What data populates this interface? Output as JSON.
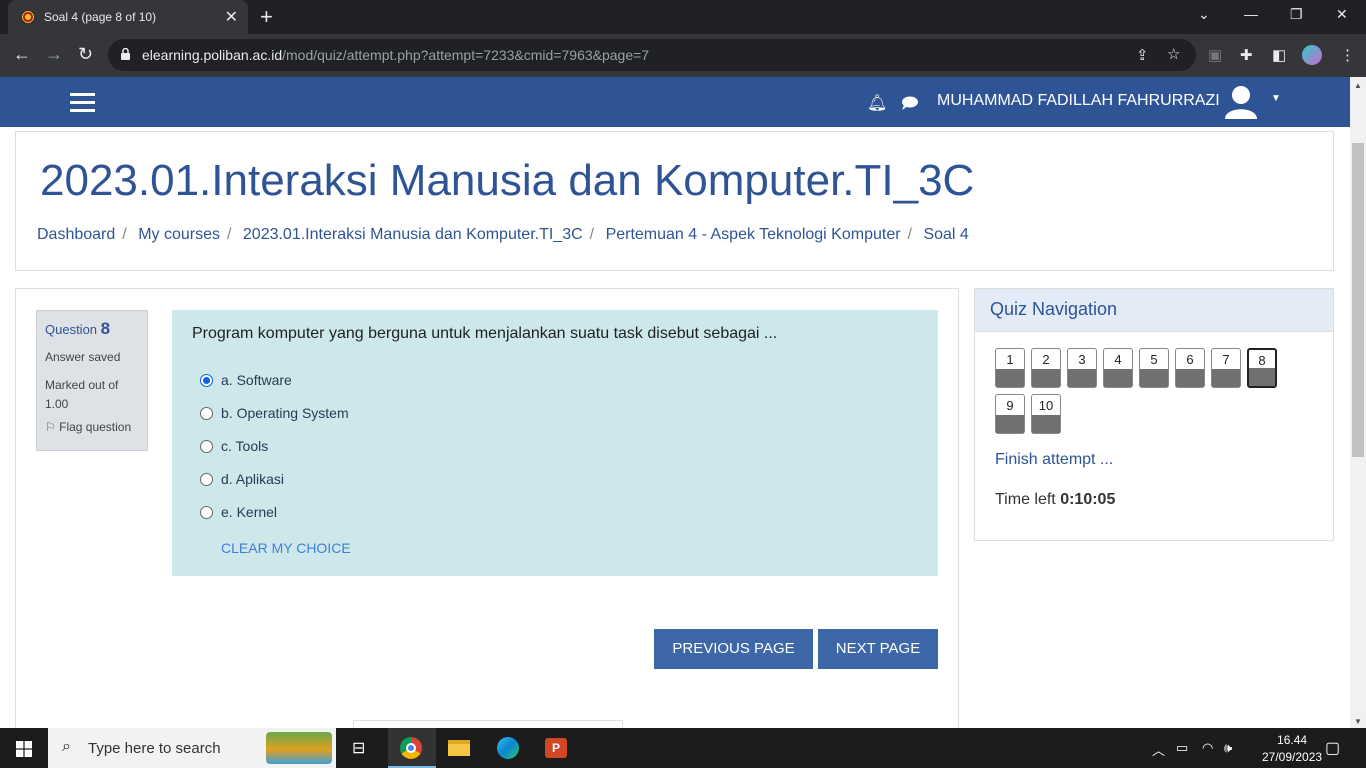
{
  "browser": {
    "tab_title": "Soal 4 (page 8 of 10)",
    "url_host": "elearning.poliban.ac.id",
    "url_path": "/mod/quiz/attempt.php?attempt=7233&cmid=7963&page=7"
  },
  "navbar": {
    "user_name": "MUHAMMAD FADILLAH FAHRURRAZI"
  },
  "header": {
    "course_title": "2023.01.Interaksi Manusia dan Komputer.TI_3C",
    "breadcrumb": [
      "Dashboard",
      "My courses",
      "2023.01.Interaksi Manusia dan Komputer.TI_3C",
      "Pertemuan 4 - Aspek Teknologi Komputer",
      "Soal 4"
    ]
  },
  "question": {
    "label": "Question",
    "number": "8",
    "status": "Answer saved",
    "marked_out_of": "Marked out of 1.00",
    "flag_label": "Flag question",
    "text": "Program komputer yang berguna untuk menjalankan suatu task disebut sebagai ...",
    "options": [
      {
        "label": "a. Software",
        "selected": true
      },
      {
        "label": "b. Operating System",
        "selected": false
      },
      {
        "label": "c. Tools",
        "selected": false
      },
      {
        "label": "d. Aplikasi",
        "selected": false
      },
      {
        "label": "e. Kernel",
        "selected": false
      }
    ],
    "clear_choice": "CLEAR MY CHOICE"
  },
  "buttons": {
    "previous": "PREVIOUS PAGE",
    "next": "NEXT PAGE"
  },
  "quiz_nav": {
    "title": "Quiz Navigation",
    "questions": [
      "1",
      "2",
      "3",
      "4",
      "5",
      "6",
      "7",
      "8",
      "9",
      "10"
    ],
    "current": "8",
    "finish_label": "Finish attempt ...",
    "time_label": "Time left",
    "time_value": "0:10:05"
  },
  "taskbar": {
    "search_placeholder": "Type here to search",
    "time": "16.44",
    "date": "27/09/2023"
  },
  "colors": {
    "brand_blue": "#2f5496",
    "question_bg": "#cde7ea",
    "button_blue": "#3d67a8"
  }
}
